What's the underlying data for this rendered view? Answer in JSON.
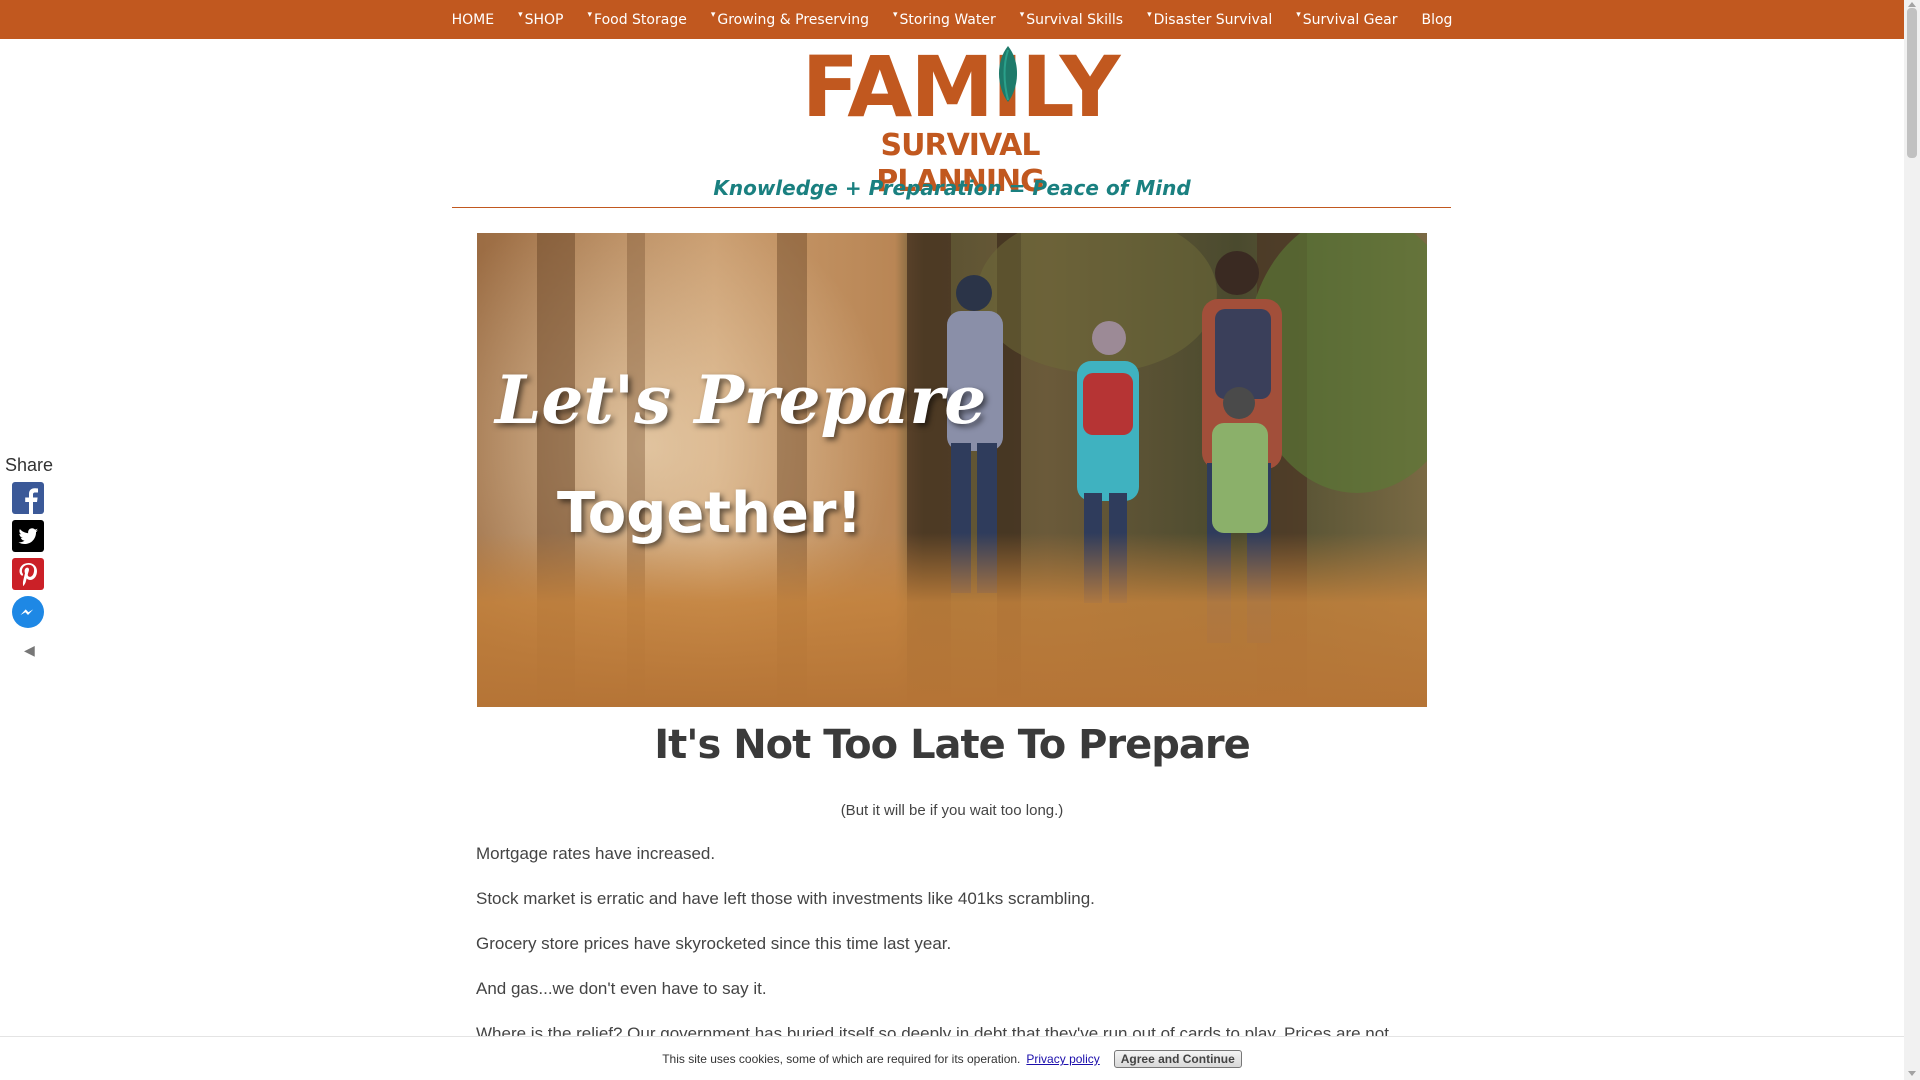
{
  "nav": {
    "items": [
      {
        "label": "HOME",
        "dropdown": false
      },
      {
        "label": "SHOP",
        "dropdown": true
      },
      {
        "label": "Food Storage",
        "dropdown": true
      },
      {
        "label": "Growing & Preserving",
        "dropdown": true
      },
      {
        "label": "Storing Water",
        "dropdown": true
      },
      {
        "label": "Survival Skills",
        "dropdown": true
      },
      {
        "label": "Disaster Survival",
        "dropdown": true
      },
      {
        "label": "Survival Gear",
        "dropdown": true
      },
      {
        "label": "Blog",
        "dropdown": false
      }
    ]
  },
  "logo": {
    "line1": "FAMILY",
    "line2": "SURVIVAL PLANNING"
  },
  "tagline": {
    "part1": "Knowledge",
    "plus": "+",
    "part2": "Preparation",
    "equals": "=",
    "part3": "Peace of Mind"
  },
  "hero": {
    "line1": "Let's Prepare",
    "line2": "Together!"
  },
  "main": {
    "heading": "It's Not Too Late To Prepare",
    "subnote": "(But it will be if you wait too long.)",
    "paragraphs": [
      "Mortgage rates have increased.",
      "Stock market is erratic and have left those with investments like 401ks scrambling.",
      "Grocery store prices have skyrocketed since this time last year.",
      "And gas...we don't even have to say it.",
      "Where is the relief? Our government has buried itself so deeply in debt that they've run out of cards to play. Prices are not"
    ]
  },
  "share": {
    "title": "Share",
    "icons": [
      "facebook-icon",
      "twitter-icon",
      "pinterest-icon",
      "messenger-icon"
    ],
    "collapse_glyph": "◀"
  },
  "cookie": {
    "text": "This site uses cookies, some of which are required for its operation.",
    "link": "Privacy policy",
    "button": "Agree and Continue"
  },
  "colors": {
    "brand_orange": "#c1581f",
    "tagline_teal": "#1a8080",
    "leaf_green": "#1e7a6a"
  }
}
